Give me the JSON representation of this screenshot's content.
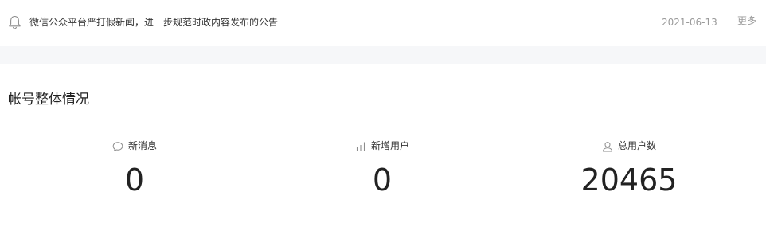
{
  "notice": {
    "icon": "bell-icon",
    "text": "微信公众平台严打假新闻，进一步规范时政内容发布的公告",
    "date": "2021-06-13",
    "more_label": "更多"
  },
  "account_overview": {
    "title": "帐号整体情况",
    "stats": [
      {
        "icon": "chat-bubble-icon",
        "label": "新消息",
        "value": "0"
      },
      {
        "icon": "bar-chart-icon",
        "label": "新增用户",
        "value": "0"
      },
      {
        "icon": "user-icon",
        "label": "总用户数",
        "value": "20465"
      }
    ]
  }
}
